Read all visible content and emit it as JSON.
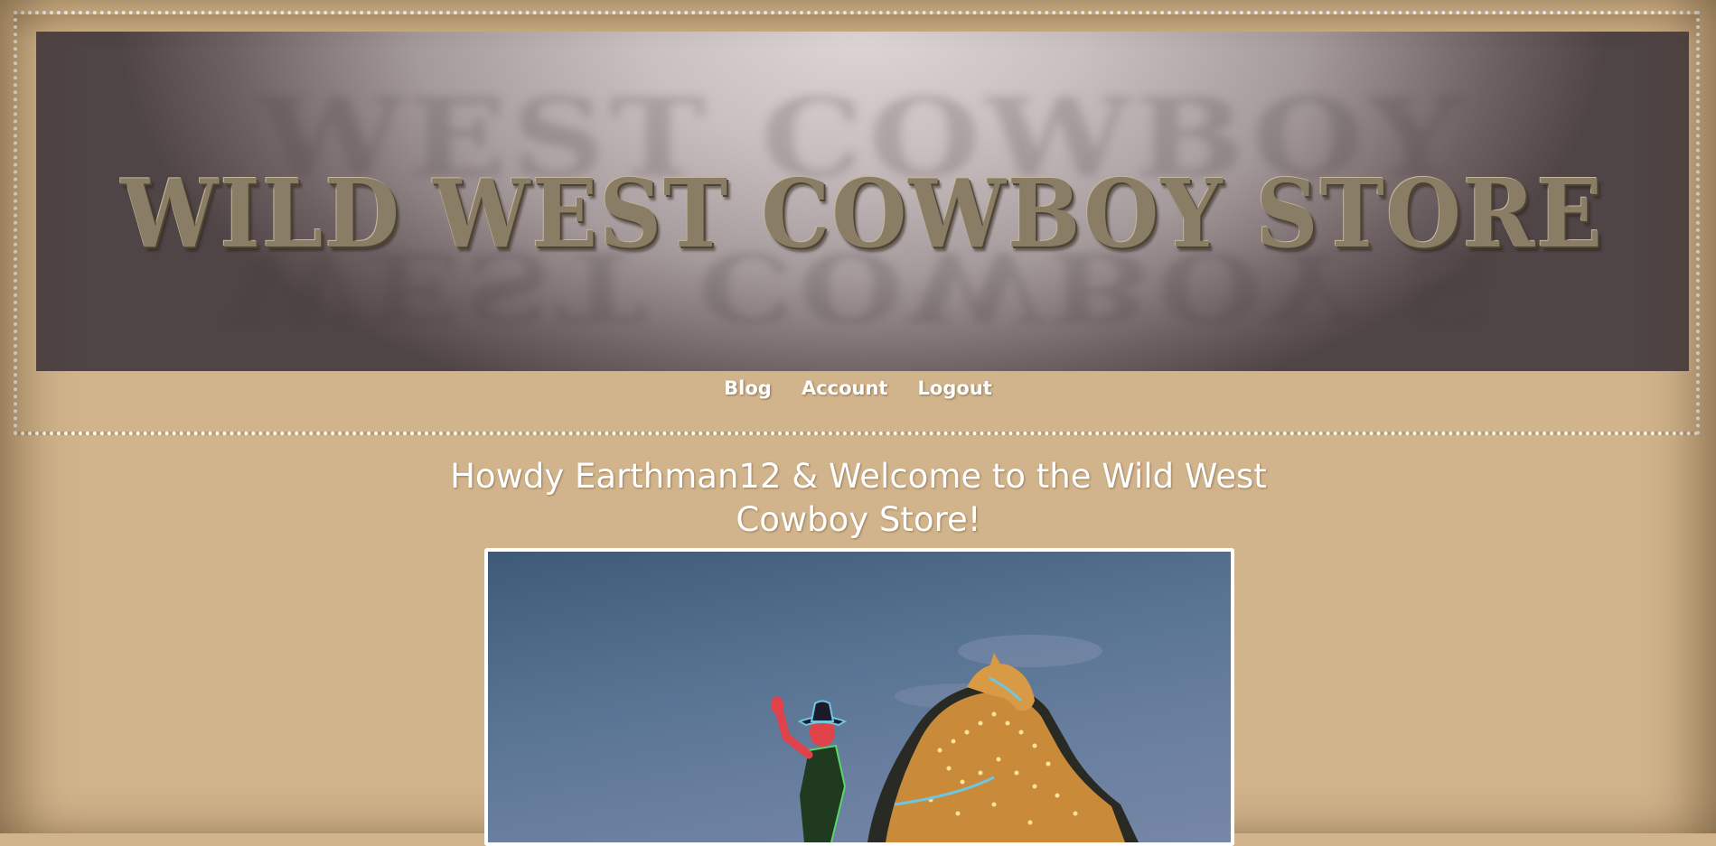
{
  "banner": {
    "title": "WILD WEST COWBOY STORE",
    "ghost_top": "WEST COWBOY",
    "ghost_bottom": "WEST COWBOY S"
  },
  "nav": {
    "items": [
      "Blog",
      "Account",
      "Logout"
    ]
  },
  "welcome": {
    "heading": "Howdy Earthman12 & Welcome to the Wild West Cowboy Store!"
  },
  "photo": {
    "subject": "neon-cowboy-on-horse-sign"
  },
  "colors": {
    "page_background": "#d2b48c",
    "frame_border": "#ffffff",
    "nav_text": "#ffffff",
    "sky": "#577392"
  }
}
